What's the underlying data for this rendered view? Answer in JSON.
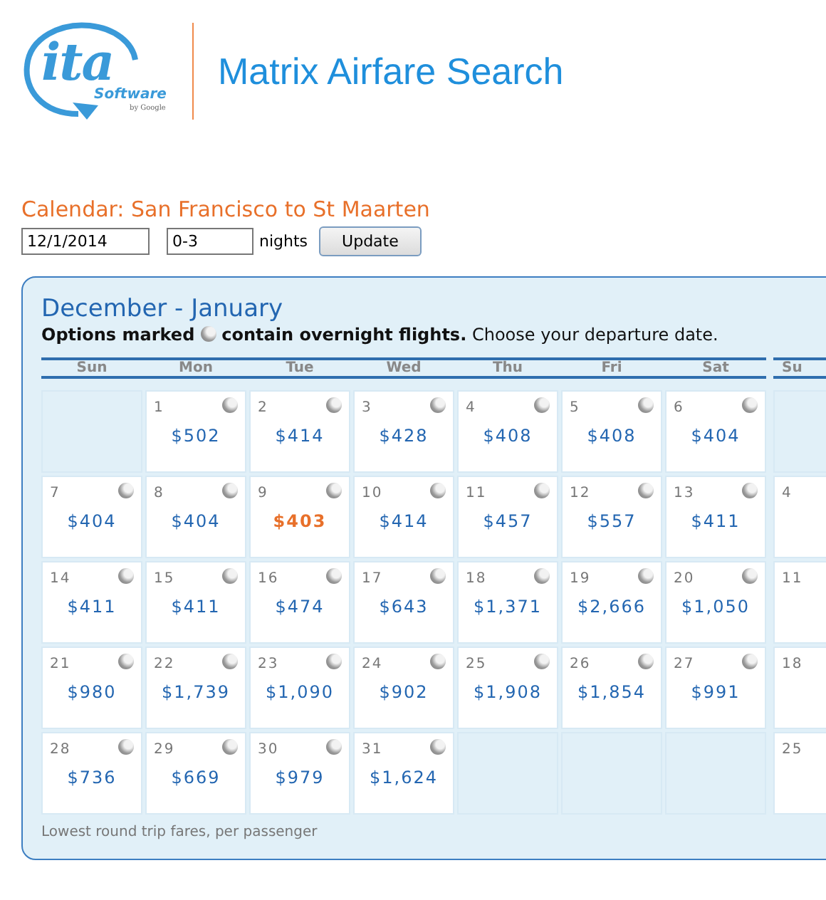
{
  "logo": {
    "mark": "ita",
    "word": "Software",
    "byline": "by Google"
  },
  "site_title": "Matrix Airfare Search",
  "calendar_heading": "Calendar: San Francisco to St Maarten",
  "form": {
    "date": "12/1/2014",
    "nights": "0-3",
    "nights_label": "nights",
    "button": "Update"
  },
  "panel": {
    "title": "December - January",
    "legend_before": "Options marked",
    "legend_after": "**contain overnight flights.** Choose your departure date.",
    "footnote": "Lowest round trip fares, per passenger",
    "weekdays": [
      "Sun",
      "Mon",
      "Tue",
      "Wed",
      "Thu",
      "Fri",
      "Sat"
    ],
    "weeks": [
      [
        {
          "kind": "empty"
        },
        {
          "kind": "day",
          "day": "1",
          "price": "$502",
          "overnight": true,
          "lowest": false
        },
        {
          "kind": "day",
          "day": "2",
          "price": "$414",
          "overnight": true,
          "lowest": false
        },
        {
          "kind": "day",
          "day": "3",
          "price": "$428",
          "overnight": true,
          "lowest": false
        },
        {
          "kind": "day",
          "day": "4",
          "price": "$408",
          "overnight": true,
          "lowest": false
        },
        {
          "kind": "day",
          "day": "5",
          "price": "$408",
          "overnight": true,
          "lowest": false
        },
        {
          "kind": "day",
          "day": "6",
          "price": "$404",
          "overnight": true,
          "lowest": false
        }
      ],
      [
        {
          "kind": "day",
          "day": "7",
          "price": "$404",
          "overnight": true,
          "lowest": false
        },
        {
          "kind": "day",
          "day": "8",
          "price": "$404",
          "overnight": true,
          "lowest": false
        },
        {
          "kind": "day",
          "day": "9",
          "price": "$403",
          "overnight": true,
          "lowest": true
        },
        {
          "kind": "day",
          "day": "10",
          "price": "$414",
          "overnight": true,
          "lowest": false
        },
        {
          "kind": "day",
          "day": "11",
          "price": "$457",
          "overnight": true,
          "lowest": false
        },
        {
          "kind": "day",
          "day": "12",
          "price": "$557",
          "overnight": true,
          "lowest": false
        },
        {
          "kind": "day",
          "day": "13",
          "price": "$411",
          "overnight": true,
          "lowest": false
        }
      ],
      [
        {
          "kind": "day",
          "day": "14",
          "price": "$411",
          "overnight": true,
          "lowest": false
        },
        {
          "kind": "day",
          "day": "15",
          "price": "$411",
          "overnight": true,
          "lowest": false
        },
        {
          "kind": "day",
          "day": "16",
          "price": "$474",
          "overnight": true,
          "lowest": false
        },
        {
          "kind": "day",
          "day": "17",
          "price": "$643",
          "overnight": true,
          "lowest": false
        },
        {
          "kind": "day",
          "day": "18",
          "price": "$1,371",
          "overnight": true,
          "lowest": false
        },
        {
          "kind": "day",
          "day": "19",
          "price": "$2,666",
          "overnight": true,
          "lowest": false
        },
        {
          "kind": "day",
          "day": "20",
          "price": "$1,050",
          "overnight": true,
          "lowest": false
        }
      ],
      [
        {
          "kind": "day",
          "day": "21",
          "price": "$980",
          "overnight": true,
          "lowest": false
        },
        {
          "kind": "day",
          "day": "22",
          "price": "$1,739",
          "overnight": true,
          "lowest": false
        },
        {
          "kind": "day",
          "day": "23",
          "price": "$1,090",
          "overnight": true,
          "lowest": false
        },
        {
          "kind": "day",
          "day": "24",
          "price": "$902",
          "overnight": true,
          "lowest": false
        },
        {
          "kind": "day",
          "day": "25",
          "price": "$1,908",
          "overnight": true,
          "lowest": false
        },
        {
          "kind": "day",
          "day": "26",
          "price": "$1,854",
          "overnight": true,
          "lowest": false
        },
        {
          "kind": "day",
          "day": "27",
          "price": "$991",
          "overnight": true,
          "lowest": false
        }
      ],
      [
        {
          "kind": "day",
          "day": "28",
          "price": "$736",
          "overnight": true,
          "lowest": false
        },
        {
          "kind": "day",
          "day": "29",
          "price": "$669",
          "overnight": true,
          "lowest": false
        },
        {
          "kind": "day",
          "day": "30",
          "price": "$979",
          "overnight": true,
          "lowest": false
        },
        {
          "kind": "day",
          "day": "31",
          "price": "$1,624",
          "overnight": true,
          "lowest": false
        },
        {
          "kind": "empty"
        },
        {
          "kind": "empty"
        },
        {
          "kind": "empty"
        }
      ]
    ],
    "next_month": {
      "weekday": "Su",
      "cells": [
        {
          "kind": "empty"
        },
        {
          "kind": "day",
          "day": "4"
        },
        {
          "kind": "day",
          "day": "11"
        },
        {
          "kind": "day",
          "day": "18"
        },
        {
          "kind": "day",
          "day": "25"
        }
      ]
    }
  }
}
